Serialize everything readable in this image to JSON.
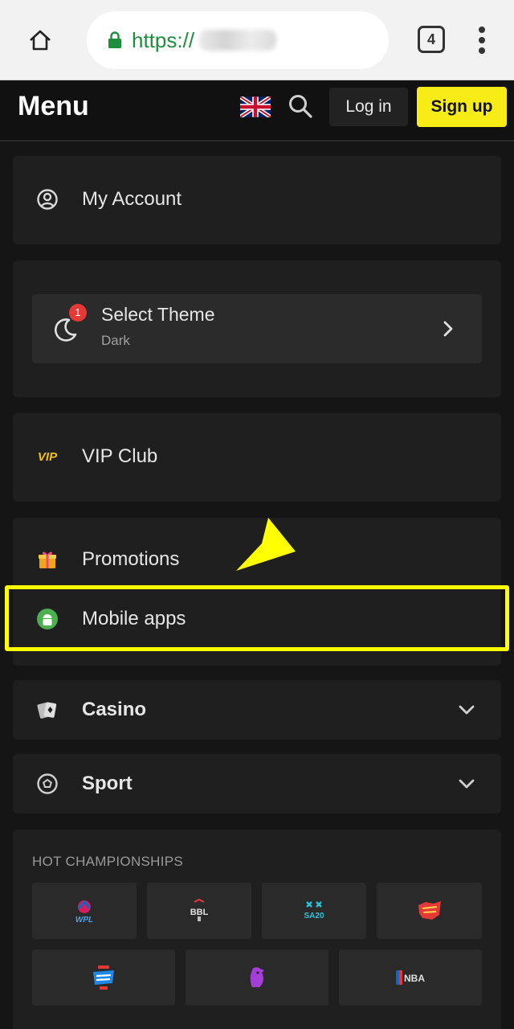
{
  "browser": {
    "url_scheme": "https://",
    "tab_count": "4"
  },
  "header": {
    "title": "Menu",
    "login_label": "Log in",
    "signup_label": "Sign up"
  },
  "menu": {
    "account": "My Account",
    "theme": {
      "title": "Select Theme",
      "subtitle": "Dark",
      "badge": "1"
    },
    "vip_icon_text": "VIP",
    "vip": "VIP Club",
    "promotions": "Promotions",
    "mobile_apps": "Mobile apps",
    "casino": "Casino",
    "sport": "Sport"
  },
  "hot": {
    "title": "HOT CHAMPIONSHIPS",
    "tiles": [
      {
        "icon": "wpl-logo",
        "text": "WPL"
      },
      {
        "icon": "bbl-logo",
        "text": "BBL"
      },
      {
        "icon": "sa20-logo",
        "text": "SA20"
      },
      {
        "icon": "league-logo"
      },
      {
        "icon": "super-smash-logo"
      },
      {
        "icon": "premier-league-logo"
      },
      {
        "icon": "nba-logo",
        "text": "NBA"
      }
    ]
  },
  "colors": {
    "background": "#151515",
    "card": "#1f1f1f",
    "accent_yellow": "#f7ec15",
    "highlight": "#ffff00",
    "url_green": "#1e8e3e",
    "badge_red": "#e53935"
  }
}
